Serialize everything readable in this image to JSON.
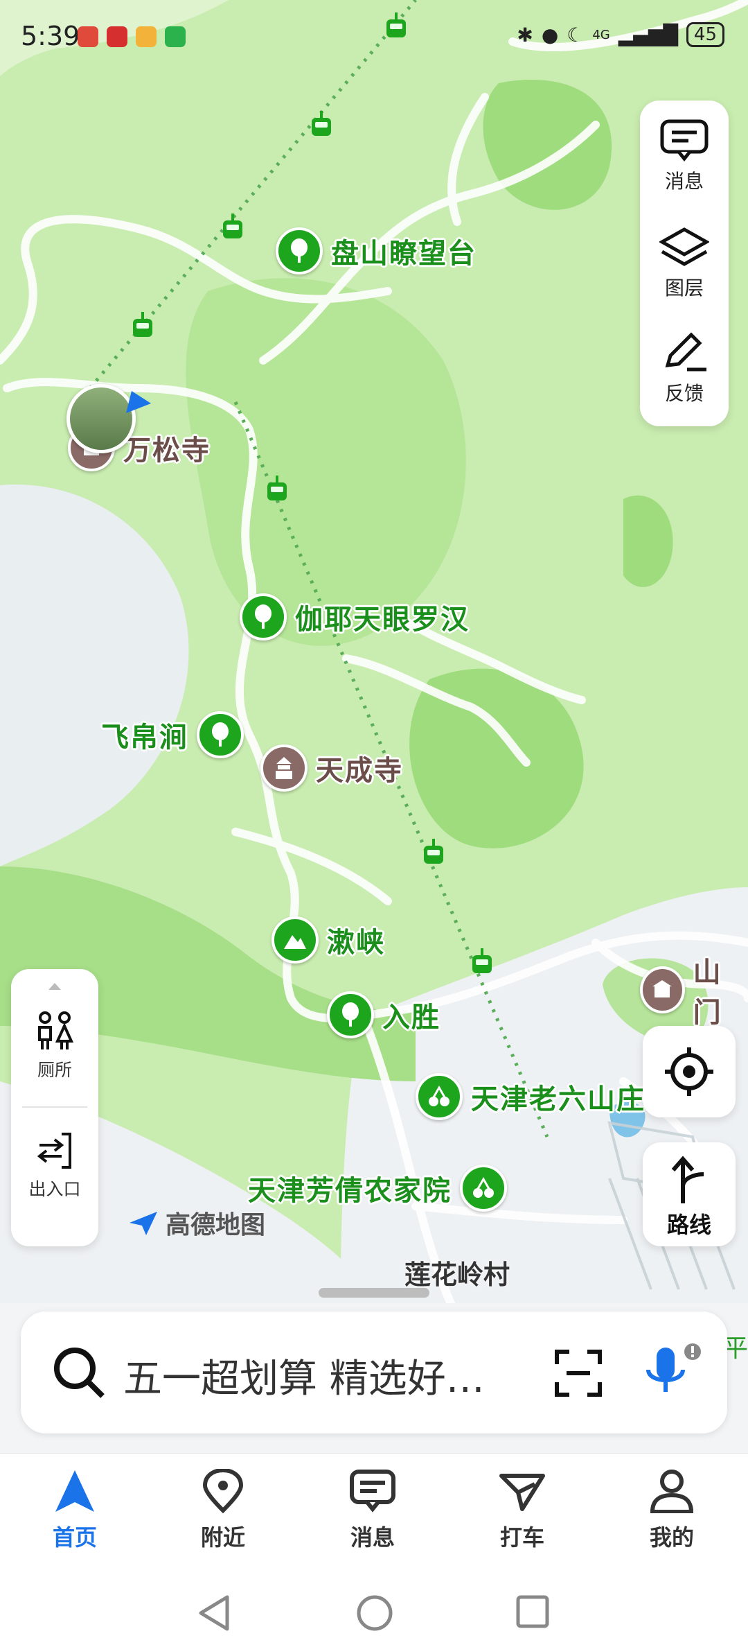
{
  "status_bar": {
    "time": "5:39",
    "network": "4G",
    "battery": "45"
  },
  "side_panel": {
    "messages": "消息",
    "layers": "图层",
    "feedback": "反馈"
  },
  "map": {
    "pois": [
      {
        "name": "盘山瞭望台",
        "type": "scenic"
      },
      {
        "name": "万松寺",
        "type": "temple"
      },
      {
        "name": "伽耶天眼罗汉",
        "type": "scenic"
      },
      {
        "name": "飞帛涧",
        "type": "scenic"
      },
      {
        "name": "天成寺",
        "type": "temple"
      },
      {
        "name": "漱峡",
        "type": "mountain"
      },
      {
        "name": "入胜",
        "type": "scenic"
      },
      {
        "name": "天津老六山庄",
        "type": "farm"
      },
      {
        "name": "天津芳倩农家院",
        "type": "farm"
      },
      {
        "name": "山门",
        "type": "temple"
      }
    ],
    "village": "莲花岭村",
    "brand": "高德地图",
    "edge_text": "平"
  },
  "left_panel": {
    "toilet": "厕所",
    "entrance": "出入口"
  },
  "route_button": {
    "label": "路线"
  },
  "search": {
    "placeholder": "五一超划算 精选好…"
  },
  "tabs": [
    {
      "label": "首页",
      "active": true
    },
    {
      "label": "附近"
    },
    {
      "label": "消息"
    },
    {
      "label": "打车"
    },
    {
      "label": "我的"
    }
  ],
  "colors": {
    "accent": "#1a73e8",
    "poi_green": "#1ea51e",
    "poi_brown": "#8a6a66"
  }
}
